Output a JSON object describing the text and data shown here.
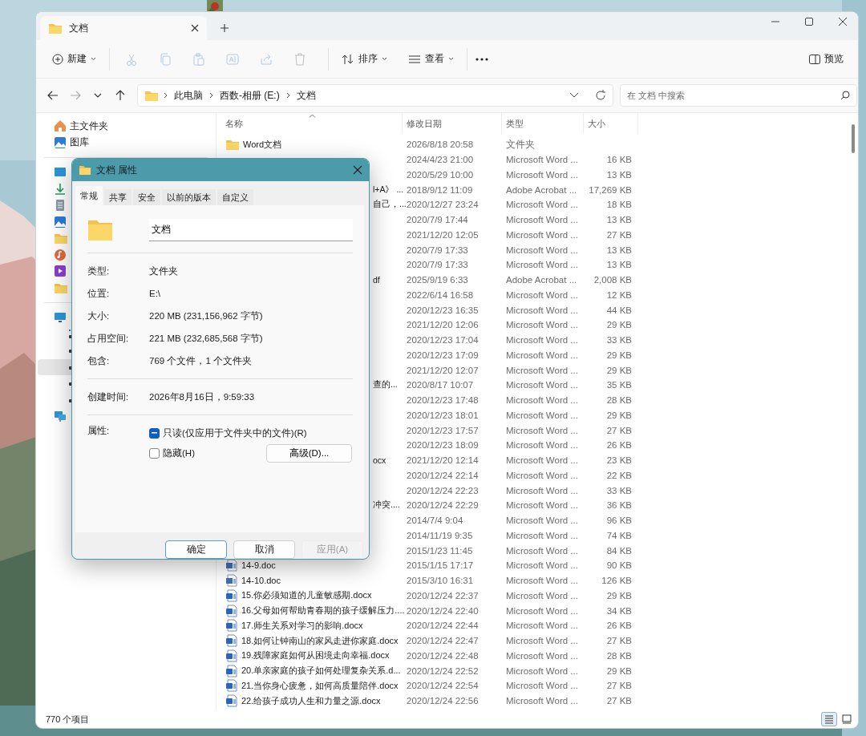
{
  "explorer": {
    "tab": {
      "title": "文档"
    },
    "toolbar": {
      "new": "新建",
      "actions": [
        {
          "kind": "cut",
          "disabled": true
        },
        {
          "kind": "copy",
          "disabled": true
        },
        {
          "kind": "paste",
          "disabled": true
        },
        {
          "kind": "rename",
          "disabled": true
        },
        {
          "kind": "share",
          "disabled": true
        },
        {
          "kind": "delete",
          "disabled": true
        }
      ],
      "sort": "排序",
      "view": "查看",
      "preview": "预览"
    },
    "nav_buttons": [
      {
        "kind": "back",
        "disabled": false
      },
      {
        "kind": "forward",
        "disabled": true
      },
      {
        "kind": "recent",
        "disabled": false
      },
      {
        "kind": "up",
        "disabled": false
      }
    ],
    "breadcrumb": [
      "此电脑",
      "西数-相册 (E:)",
      "文档"
    ],
    "search": {
      "placeholder": "在 文档 中搜索"
    },
    "sidebar": {
      "sections": [
        [
          {
            "kind": "home",
            "label": "主文件夹",
            "selected": false
          },
          {
            "kind": "gallery",
            "label": "图库",
            "selected": false
          }
        ],
        [
          {
            "kind": "desktop",
            "selected": false
          },
          {
            "kind": "download",
            "selected": false
          },
          {
            "kind": "document",
            "selected": false
          },
          {
            "kind": "pictures",
            "selected": false
          },
          {
            "kind": "folder",
            "selected": false
          },
          {
            "kind": "music",
            "selected": false
          },
          {
            "kind": "video",
            "selected": false
          },
          {
            "kind": "folder",
            "selected": false
          }
        ],
        [
          {
            "kind": "pc",
            "selected": false,
            "children": [
              {
                "kind": "drive-os",
                "selected": false
              },
              {
                "kind": "drive",
                "selected": false
              },
              {
                "kind": "drive",
                "selected": true
              },
              {
                "kind": "drive",
                "selected": false
              },
              {
                "kind": "drive",
                "selected": false
              }
            ]
          },
          {
            "kind": "network",
            "selected": false
          }
        ]
      ]
    },
    "columns": [
      {
        "label": "名称",
        "sorted": true
      },
      {
        "label": "修改日期",
        "sorted": false
      },
      {
        "label": "类型",
        "sorted": false
      },
      {
        "label": "大小",
        "sorted": false
      }
    ],
    "files": [
      {
        "kind": "folder",
        "name": "Word文档",
        "modified": "2026/8/18 20:58",
        "type": "文件夹"
      },
      {
        "modified": "2024/4/23 21:00",
        "type": "Microsoft Word ...",
        "size": "16 KB"
      },
      {
        "modified": "2020/5/29 10:00",
        "type": "Microsoft Word ...",
        "size": "13 KB"
      },
      {
        "name_fragment": "l+A》 ...",
        "modified": "2018/9/12 11:09",
        "type": "Adobe Acrobat ...",
        "size": "17,269 KB"
      },
      {
        "name_fragment": "自己，...",
        "modified": "2020/12/27 23:24",
        "type": "Microsoft Word ...",
        "size": "18 KB"
      },
      {
        "modified": "2020/7/9 17:44",
        "type": "Microsoft Word ...",
        "size": "13 KB"
      },
      {
        "modified": "2021/12/20 12:05",
        "type": "Microsoft Word ...",
        "size": "27 KB"
      },
      {
        "modified": "2020/7/9 17:33",
        "type": "Microsoft Word ...",
        "size": "13 KB"
      },
      {
        "modified": "2020/7/9 17:33",
        "type": "Microsoft Word ...",
        "size": "13 KB"
      },
      {
        "name_fragment": "df",
        "modified": "2025/9/19 6:33",
        "type": "Adobe Acrobat ...",
        "size": "2,008 KB"
      },
      {
        "modified": "2022/6/14 16:58",
        "type": "Microsoft Word ...",
        "size": "12 KB"
      },
      {
        "modified": "2020/12/23 16:35",
        "type": "Microsoft Word ...",
        "size": "44 KB"
      },
      {
        "modified": "2021/12/20 12:06",
        "type": "Microsoft Word ...",
        "size": "29 KB"
      },
      {
        "modified": "2020/12/23 17:04",
        "type": "Microsoft Word ...",
        "size": "33 KB"
      },
      {
        "modified": "2020/12/23 17:09",
        "type": "Microsoft Word ...",
        "size": "29 KB"
      },
      {
        "modified": "2021/12/20 12:07",
        "type": "Microsoft Word ...",
        "size": "29 KB"
      },
      {
        "name_fragment": "查的...",
        "modified": "2020/8/17 10:07",
        "type": "Microsoft Word ...",
        "size": "35 KB"
      },
      {
        "modified": "2020/12/23 17:48",
        "type": "Microsoft Word ...",
        "size": "28 KB"
      },
      {
        "modified": "2020/12/23 18:01",
        "type": "Microsoft Word ...",
        "size": "29 KB"
      },
      {
        "modified": "2020/12/23 17:57",
        "type": "Microsoft Word ...",
        "size": "27 KB"
      },
      {
        "modified": "2020/12/23 18:09",
        "type": "Microsoft Word ...",
        "size": "26 KB"
      },
      {
        "name_fragment": "ocx",
        "modified": "2021/12/20 12:14",
        "type": "Microsoft Word ...",
        "size": "23 KB"
      },
      {
        "modified": "2020/12/24 22:14",
        "type": "Microsoft Word ...",
        "size": "22 KB"
      },
      {
        "modified": "2020/12/24 22:23",
        "type": "Microsoft Word ...",
        "size": "33 KB"
      },
      {
        "name_fragment": "冲突....",
        "modified": "2020/12/24 22:29",
        "type": "Microsoft Word ...",
        "size": "36 KB"
      },
      {
        "modified": "2014/7/4 9:04",
        "type": "Microsoft Word ...",
        "size": "96 KB"
      },
      {
        "modified": "2014/11/19 9:35",
        "type": "Microsoft Word ...",
        "size": "74 KB"
      },
      {
        "modified": "2015/1/23 11:45",
        "type": "Microsoft Word ...",
        "size": "84 KB"
      },
      {
        "kind": "doc",
        "name": "14-9.doc",
        "modified": "2015/1/15 17:17",
        "type": "Microsoft Word ...",
        "size": "90 KB"
      },
      {
        "kind": "doc",
        "name": "14-10.doc",
        "modified": "2015/3/10 16:31",
        "type": "Microsoft Word ...",
        "size": "126 KB"
      },
      {
        "kind": "docx",
        "name": "15.你必须知道的儿童敏感期.docx",
        "modified": "2020/12/24 22:37",
        "type": "Microsoft Word ...",
        "size": "29 KB"
      },
      {
        "kind": "docx",
        "name": "16.父母如何帮助青春期的孩子缓解压力....",
        "modified": "2020/12/24 22:40",
        "type": "Microsoft Word ...",
        "size": "34 KB"
      },
      {
        "kind": "docx",
        "name": "17.师生关系对学习的影响.docx",
        "modified": "2020/12/24 22:44",
        "type": "Microsoft Word ...",
        "size": "26 KB"
      },
      {
        "kind": "docx",
        "name": "18.如何让钟南山的家风走进你家庭.docx",
        "modified": "2020/12/24 22:47",
        "type": "Microsoft Word ...",
        "size": "27 KB"
      },
      {
        "kind": "docx",
        "name": "19.残障家庭如何从困境走向幸福.docx",
        "modified": "2020/12/24 22:48",
        "type": "Microsoft Word ...",
        "size": "28 KB"
      },
      {
        "kind": "docx",
        "name": "20.单亲家庭的孩子如何处理复杂关系.d...",
        "modified": "2020/12/24 22:52",
        "type": "Microsoft Word ...",
        "size": "29 KB"
      },
      {
        "kind": "docx",
        "name": "21.当你身心疲惫，如何高质量陪伴.docx",
        "modified": "2020/12/24 22:54",
        "type": "Microsoft Word ...",
        "size": "27 KB"
      },
      {
        "kind": "docx",
        "name": "22.给孩子成功人生和力量之源.docx",
        "modified": "2020/12/24 22:56",
        "type": "Microsoft Word ...",
        "size": "27 KB"
      }
    ],
    "status_bar": {
      "count": "770 个项目",
      "views": [
        {
          "kind": "details",
          "selected": true
        },
        {
          "kind": "tiles",
          "selected": false
        }
      ]
    }
  },
  "dialog": {
    "title": "文档 属性",
    "tabs": [
      {
        "label": "常规",
        "selected": true
      },
      {
        "label": "共享",
        "selected": false
      },
      {
        "label": "安全",
        "selected": false
      },
      {
        "label": "以前的版本",
        "selected": false
      },
      {
        "label": "自定义",
        "selected": false
      }
    ],
    "name": "文档",
    "groups": [
      [
        {
          "label": "类型:",
          "value": "文件夹"
        },
        {
          "label": "位置:",
          "value": "E:\\"
        },
        {
          "label": "大小:",
          "value": "220 MB (231,156,962 字节)"
        },
        {
          "label": "占用空间:",
          "value": "221 MB (232,685,568 字节)"
        },
        {
          "label": "包含:",
          "value": "769 个文件，1 个文件夹"
        }
      ],
      [
        {
          "label": "创建时间:",
          "value": "2026年8月16日，9:59:33"
        }
      ]
    ],
    "attributes": {
      "label": "属性:",
      "options": [
        {
          "label": "只读(仅应用于文件夹中的文件)(R)",
          "indeterminate": true
        },
        {
          "label": "隐藏(H)",
          "checked": false
        }
      ],
      "advanced": "高级(D)..."
    },
    "buttons": [
      {
        "label": "确定",
        "default": true,
        "disabled": false
      },
      {
        "label": "取消",
        "default": false,
        "disabled": false
      },
      {
        "label": "应用(A)",
        "default": false,
        "disabled": true
      }
    ]
  }
}
